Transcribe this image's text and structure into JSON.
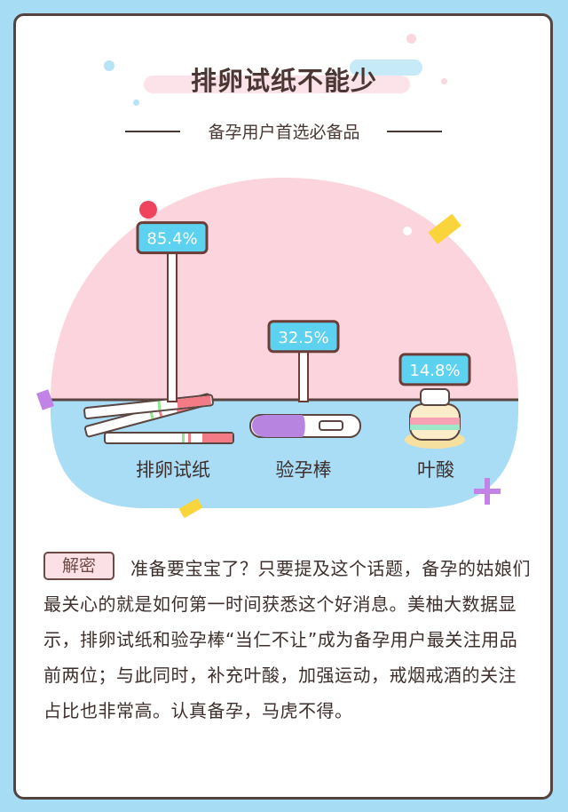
{
  "title": "排卵试纸不能少",
  "subtitle": "备孕用户首选必备品",
  "chart_data": {
    "type": "bar",
    "categories": [
      "排卵试纸",
      "验孕棒",
      "叶酸"
    ],
    "values": [
      85.4,
      32.5,
      14.8
    ],
    "value_labels": [
      "85.4%",
      "32.5%",
      "14.8%"
    ],
    "unit": "%",
    "colors": {
      "tag_fill": "#5dd1f0",
      "tag_border": "#6b3d36",
      "pole": "#ffffff",
      "background_pink": "#fbd4dd",
      "table_blue": "#a9dcf5"
    }
  },
  "intro": {
    "badge": "解密",
    "text": "准备要宝宝了？只要提及这个话题，备孕的姑娘们最关心的就是如何第一时间获悉这个好消息。美柚大数据显示，排卵试纸和验孕棒“当仁不让”成为备孕用户最关注用品前两位；与此同时，补充叶酸，加强运动，戒烟戒酒的关注占比也非常高。认真备孕，马虎不得。"
  }
}
